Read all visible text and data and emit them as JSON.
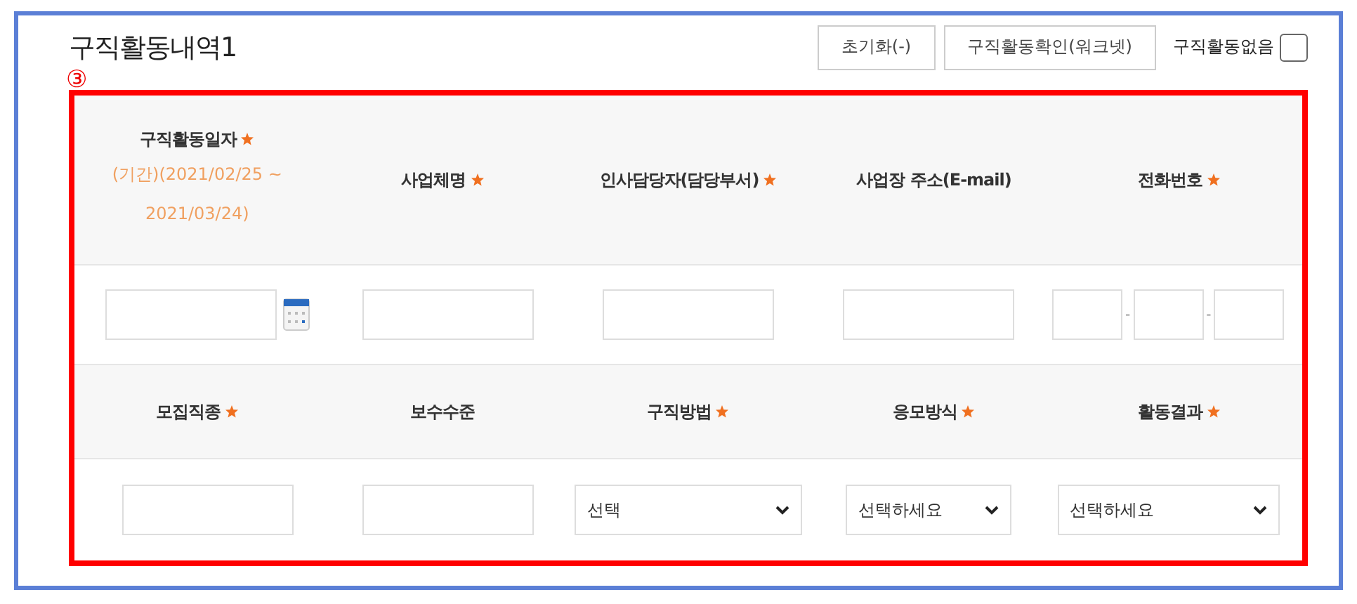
{
  "title": "구직활동내역1",
  "buttons": [
    {
      "label": "초기화(-)"
    },
    {
      "label": "구직활동확인(워크넷)"
    }
  ],
  "no_activity": {
    "label": "구직활동없음",
    "checked": false
  },
  "section_marker": "③",
  "rows": [
    {
      "headers": [
        {
          "label": "구직활동일자",
          "required": true,
          "note": "(기간)(2021/02/25 ~ 2021/03/24)"
        },
        {
          "label": "사업체명",
          "required": true
        },
        {
          "label": "인사담당자(담당부서)",
          "required": true
        },
        {
          "label": "사업장 주소(E-mail)",
          "required": false
        },
        {
          "label": "전화번호",
          "required": true
        }
      ],
      "fields": [
        {
          "kind": "date"
        },
        {
          "kind": "text"
        },
        {
          "kind": "text"
        },
        {
          "kind": "text"
        },
        {
          "kind": "phone",
          "separators": [
            "-",
            "-"
          ]
        }
      ]
    },
    {
      "headers": [
        {
          "label": "모집직종",
          "required": true
        },
        {
          "label": "보수수준",
          "required": false
        },
        {
          "label": "구직방법",
          "required": true
        },
        {
          "label": "응모방식",
          "required": true
        },
        {
          "label": "활동결과",
          "required": true
        }
      ],
      "fields": [
        {
          "kind": "text"
        },
        {
          "kind": "text"
        },
        {
          "kind": "select",
          "value": "선택"
        },
        {
          "kind": "select",
          "value": "선택하세요"
        },
        {
          "kind": "select",
          "value": "선택하세요"
        }
      ]
    }
  ]
}
